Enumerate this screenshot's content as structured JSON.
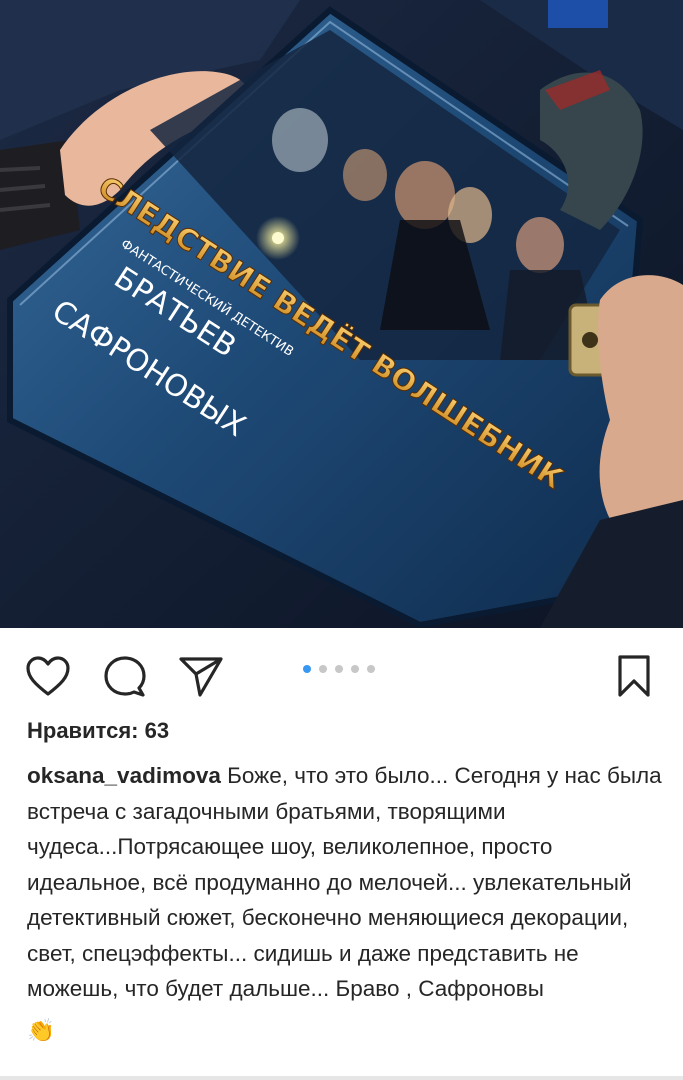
{
  "photo": {
    "cover_title": "СЛЕДСТВИЕ ВЕДЁТ ВОЛШЕБНИК",
    "cover_genre": "ФАНТАСТИЧЕСКИЙ ДЕТЕКТИВ",
    "cover_author_line1": "БРАТЬЕВ",
    "cover_author_line2": "САФРОНОВЫХ"
  },
  "actions": {
    "like_icon": "heart-outline-icon",
    "comment_icon": "comment-bubble-icon",
    "share_icon": "paper-plane-icon",
    "save_icon": "bookmark-icon",
    "carousel_count": 5,
    "carousel_active": 1,
    "active_dot_color": "#3897f0"
  },
  "post": {
    "likes_text": "Нравится: 63",
    "username": "oksana_vadimova",
    "caption": "Боже, что это было... Сегодня у нас была встреча с загадочными братьями, творящими чудеса...Потрясающее шоу, великолепное, просто идеальное, всё продуманно до мелочей... увлекательный детективный сюжет, бесконечно меняющиеся декорации, свет, спецэффекты... сидишь и даже представить не можешь, что будет дальше... Браво , Сафроновы",
    "emoji": "👏"
  }
}
